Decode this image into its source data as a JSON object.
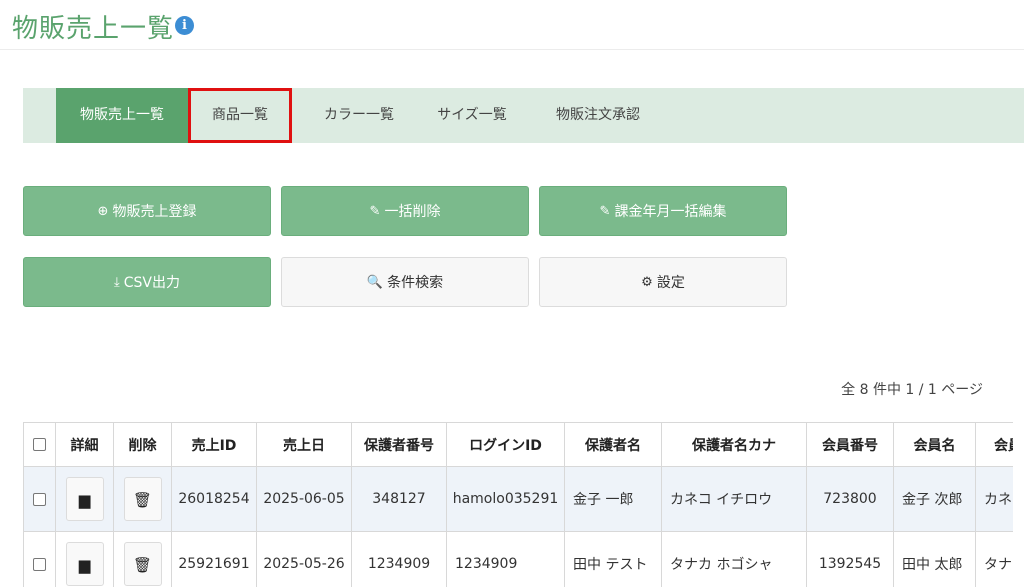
{
  "page": {
    "title": "物販売上一覧",
    "info_icon": "i"
  },
  "tabs": [
    {
      "label": "物販売上一覧",
      "active": true
    },
    {
      "label": "商品一覧",
      "highlighted": true
    },
    {
      "label": "カラー一覧"
    },
    {
      "label": "サイズ一覧"
    },
    {
      "label": "物販注文承認"
    }
  ],
  "actions": {
    "register": {
      "label": "物販売上登録",
      "icon": "plus-circle-icon",
      "glyph": "⊕"
    },
    "bulk_delete": {
      "label": "一括削除",
      "icon": "pencil-icon",
      "glyph": "✎"
    },
    "bulk_edit": {
      "label": "課金年月一括編集",
      "icon": "pencil-icon",
      "glyph": "✎"
    },
    "csv": {
      "label": "CSV出力",
      "icon": "download-icon",
      "glyph": "⤓"
    },
    "search": {
      "label": "条件検索",
      "icon": "search-icon",
      "glyph": "🔍"
    },
    "settings": {
      "label": "設定",
      "icon": "gear-icon",
      "glyph": "⚙"
    }
  },
  "paging": {
    "text": "全 8 件中 1 / 1 ページ"
  },
  "table": {
    "columns": [
      "詳細",
      "削除",
      "売上ID",
      "売上日",
      "保護者番号",
      "ログインID",
      "保護者名",
      "保護者名カナ",
      "会員番号",
      "会員名",
      "会員"
    ],
    "detail_glyph": "▆",
    "delete_glyph": "🗑",
    "rows": [
      [
        "26018254",
        "2025-06-05",
        "348127",
        "hamolo035291",
        "金子 一郎",
        "カネコ イチロウ",
        "723800",
        "金子 次郎",
        "カネコ"
      ],
      [
        "25921691",
        "2025-05-26",
        "1234909",
        "1234909",
        "田中 テスト",
        "タナカ ホゴシャ",
        "1392545",
        "田中 太郎",
        "タナカ"
      ]
    ]
  },
  "colors": {
    "brand_green": "#5aa36d",
    "button_green": "#7bba8c",
    "tab_bg": "#dcebe1",
    "highlight_red": "#e01010"
  }
}
